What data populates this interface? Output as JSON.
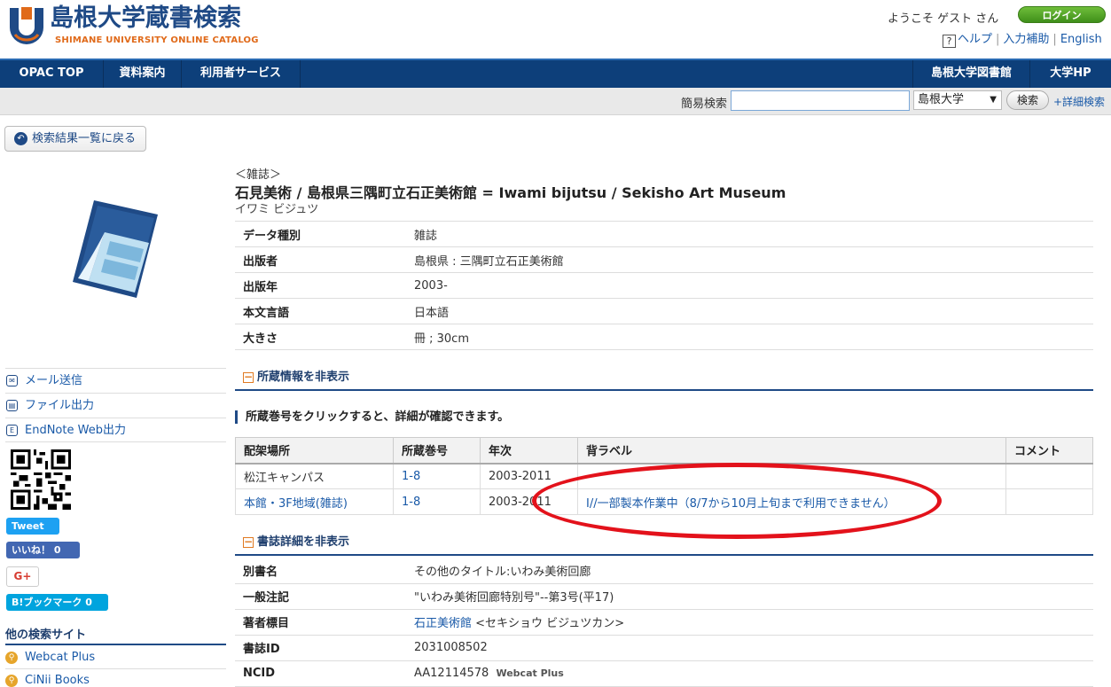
{
  "header": {
    "logo_title": "島根大学蔵書検索",
    "logo_sub": "SHIMANE UNIVERSITY ONLINE CATALOG",
    "welcome": "ようこそ  ゲスト さん",
    "login": "ログイン",
    "help": "ヘルプ",
    "input_help": "入力補助",
    "english": "English"
  },
  "nav": {
    "items": [
      "OPAC TOP",
      "資料案内",
      "利用者サービス"
    ],
    "right_items": [
      "島根大学図書館",
      "大学HP"
    ]
  },
  "search": {
    "label": "簡易検索",
    "value": "",
    "scope": "島根大学",
    "button": "検索",
    "advanced": "+詳細検索"
  },
  "back_button": "検索結果一覧に戻る",
  "sidebar": {
    "actions": [
      "メール送信",
      "ファイル出力",
      "EndNote Web出力"
    ],
    "tweet": "Tweet",
    "like": "いいね！ 0",
    "gplus": "G+",
    "bookmark": "B!ブックマーク  0",
    "other_heading": "他の検索サイト",
    "other_sites": [
      "Webcat Plus",
      "CiNii Books"
    ]
  },
  "record": {
    "type_tag": "＜雑誌＞",
    "title": "石見美術 / 島根県三隅町立石正美術館 = Iwami bijutsu / Sekisho Art Museum",
    "kana": "イワミ ビジュツ",
    "fields": [
      {
        "key": "データ種別",
        "value": "雑誌"
      },
      {
        "key": "出版者",
        "value": "島根県 : 三隅町立石正美術館"
      },
      {
        "key": "出版年",
        "value": "2003-"
      },
      {
        "key": "本文言語",
        "value": "日本語"
      },
      {
        "key": "大きさ",
        "value": "冊 ; 30cm"
      }
    ]
  },
  "holdings": {
    "toggle": "所蔵情報を非表示",
    "note": "所蔵巻号をクリックすると、詳細が確認できます。",
    "columns": [
      "配架場所",
      "所蔵巻号",
      "年次",
      "背ラベル",
      "コメント"
    ],
    "rows": [
      {
        "location": "松江キャンパス",
        "volume": "1-8",
        "year": "2003-2011",
        "label": "",
        "comment": ""
      },
      {
        "location": "本館・3F地域(雑誌)",
        "volume": "1-8",
        "year": "2003-2011",
        "label": "I//一部製本作業中（8/7から10月上旬まで利用できません）",
        "comment": ""
      }
    ]
  },
  "bib_details": {
    "toggle": "書誌詳細を非表示",
    "fields": [
      {
        "key": "別書名",
        "value": "その他のタイトル:いわみ美術回廊"
      },
      {
        "key": "一般注記",
        "value": "\"いわみ美術回廊特別号\"--第3号(平17)"
      },
      {
        "key": "著者標目",
        "value_link": "石正美術館",
        "value": " <セキショウ ビジュツカン>"
      },
      {
        "key": "書誌ID",
        "value": "2031008502"
      },
      {
        "key": "NCID",
        "value": "AA12114578",
        "extra": "Webcat Plus"
      }
    ]
  }
}
